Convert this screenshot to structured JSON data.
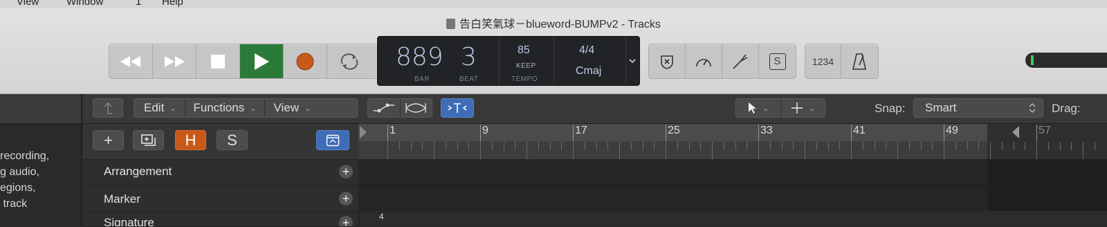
{
  "menubar": {
    "items": [
      "View",
      "Window",
      "1",
      "Help"
    ]
  },
  "window": {
    "title": "告白笑氣球－blueword-BUMPv2 - Tracks"
  },
  "transport": {
    "rewind_icon": "rewind-icon",
    "forward_icon": "fast-forward-icon",
    "stop_icon": "stop-icon",
    "play_icon": "play-icon",
    "record_icon": "record-icon",
    "cycle_icon": "cycle-icon",
    "play_color": "#2b7a38",
    "record_color": "#c9591a"
  },
  "lcd": {
    "bar": "889",
    "beat": "3",
    "bar_label": "BAR",
    "beat_label": "BEAT",
    "tempo": "85",
    "tempo_mode": "KEEP",
    "tempo_label": "TEMPO",
    "signature": "4/4",
    "key": "Cmaj"
  },
  "tools": {
    "count_in_label": "1234",
    "smart_controls_label": "S"
  },
  "tracks_bar": {
    "edit": "Edit",
    "functions": "Functions",
    "view": "View",
    "snap_label": "Snap:",
    "snap_value": "Smart",
    "drag_label": "Drag:"
  },
  "header": {
    "add": "+",
    "h_label": "H",
    "s_label": "S"
  },
  "global_tracks": [
    {
      "name": "Arrangement"
    },
    {
      "name": "Marker"
    },
    {
      "name": "Signature"
    }
  ],
  "help_text": "recording,\ng audio,\negions,\n track",
  "ruler": {
    "bars": [
      "1",
      "9",
      "17",
      "25",
      "33",
      "41",
      "49",
      "57"
    ]
  },
  "signature_lane": {
    "value": "4"
  },
  "colors": {
    "accent_blue": "#3e6cb6",
    "hide_orange": "#c9591a",
    "play_green": "#2b7a38"
  }
}
